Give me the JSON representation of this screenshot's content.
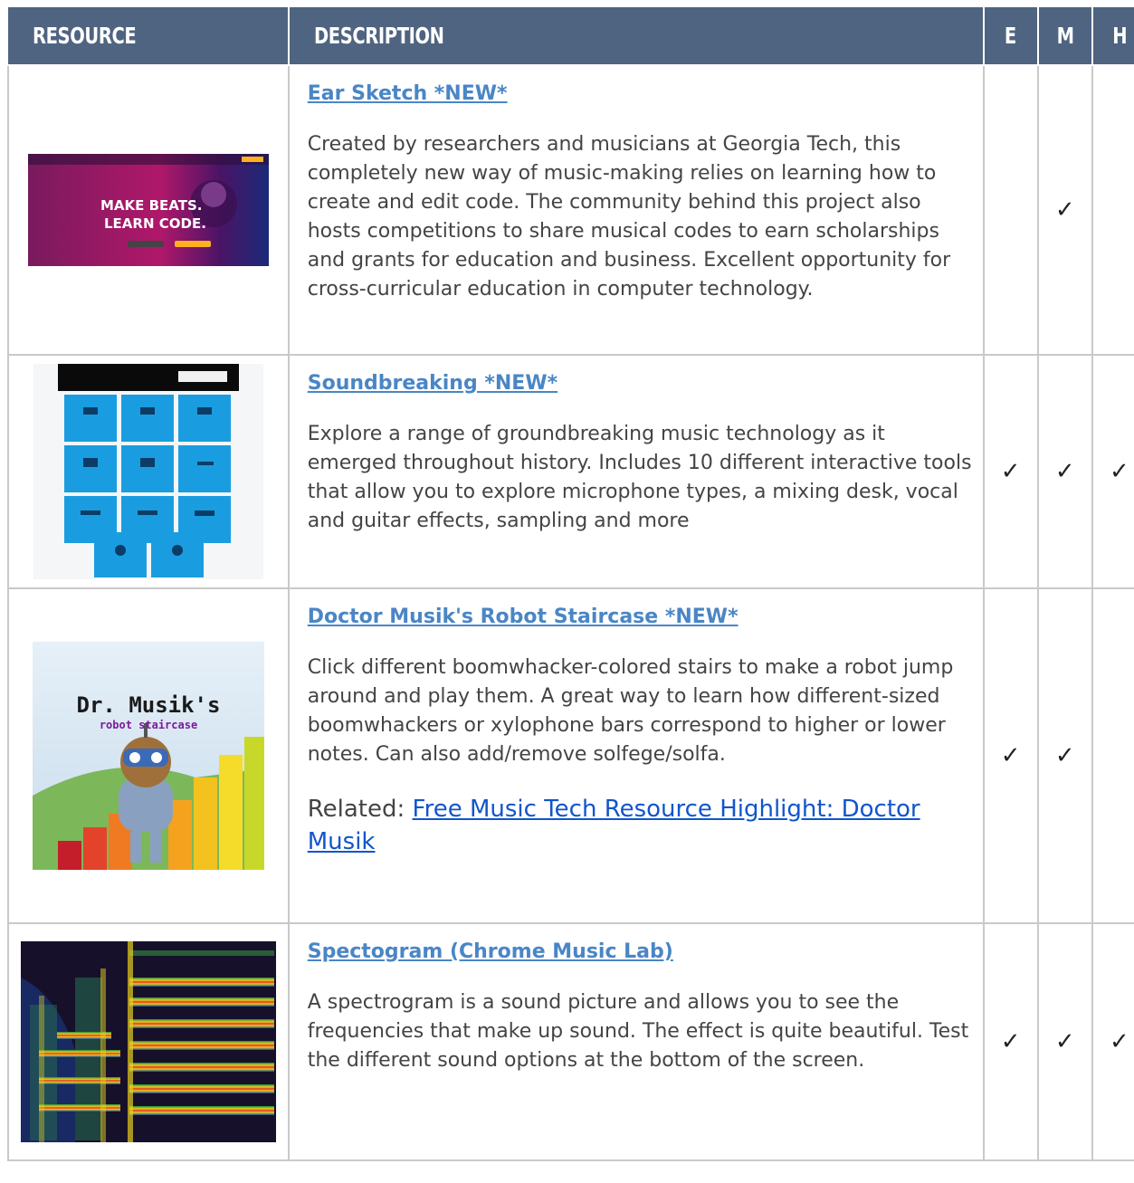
{
  "columns": {
    "resource": "RESOURCE",
    "description": "DESCRIPTION",
    "e": "E",
    "m": "M",
    "h": "H"
  },
  "check_mark": "✓",
  "rows": [
    {
      "title": "Ear Sketch *NEW*",
      "body": "Created by researchers and musicians at Georgia Tech, this completely new way of music-making relies on learning how to create and edit code. The community behind this project also hosts competitions to share musical codes to earn scholarships and grants for education and business. Excellent opportunity for cross-curricular education in computer technology.",
      "thumb_text": "MAKE BEATS.\nLEARN CODE.",
      "e": "",
      "m": "✓",
      "h": ""
    },
    {
      "title": "Soundbreaking *NEW*",
      "body": "Explore a range of groundbreaking music technology as it emerged throughout history. Includes 10 different interactive tools that allow you to explore microphone types, a mixing desk, vocal and guitar effects, sampling and more",
      "e": "✓",
      "m": "✓",
      "h": "✓"
    },
    {
      "title": "Doctor Musik's Robot Staircase *NEW*",
      "body": "Click different boomwhacker-colored stairs to make a robot jump around and play them. A great way to learn how different-sized boomwhackers or xylophone bars correspond to higher or lower notes. Can also add/remove solfege/solfa.",
      "related_prefix": "Related: ",
      "related_link": "Free Music Tech Resource Highlight: Doctor Musik",
      "thumb_title": "Dr. Musik's",
      "thumb_sub": "robot staircase",
      "e": "✓",
      "m": "✓",
      "h": ""
    },
    {
      "title": "Spectogram (Chrome Music Lab)",
      "body": "A spectrogram is a sound picture and allows you to see the frequencies that make up sound.  The effect is quite beautiful.  Test the different sound options at the bottom of the screen.",
      "e": "✓",
      "m": "✓",
      "h": "✓"
    }
  ]
}
